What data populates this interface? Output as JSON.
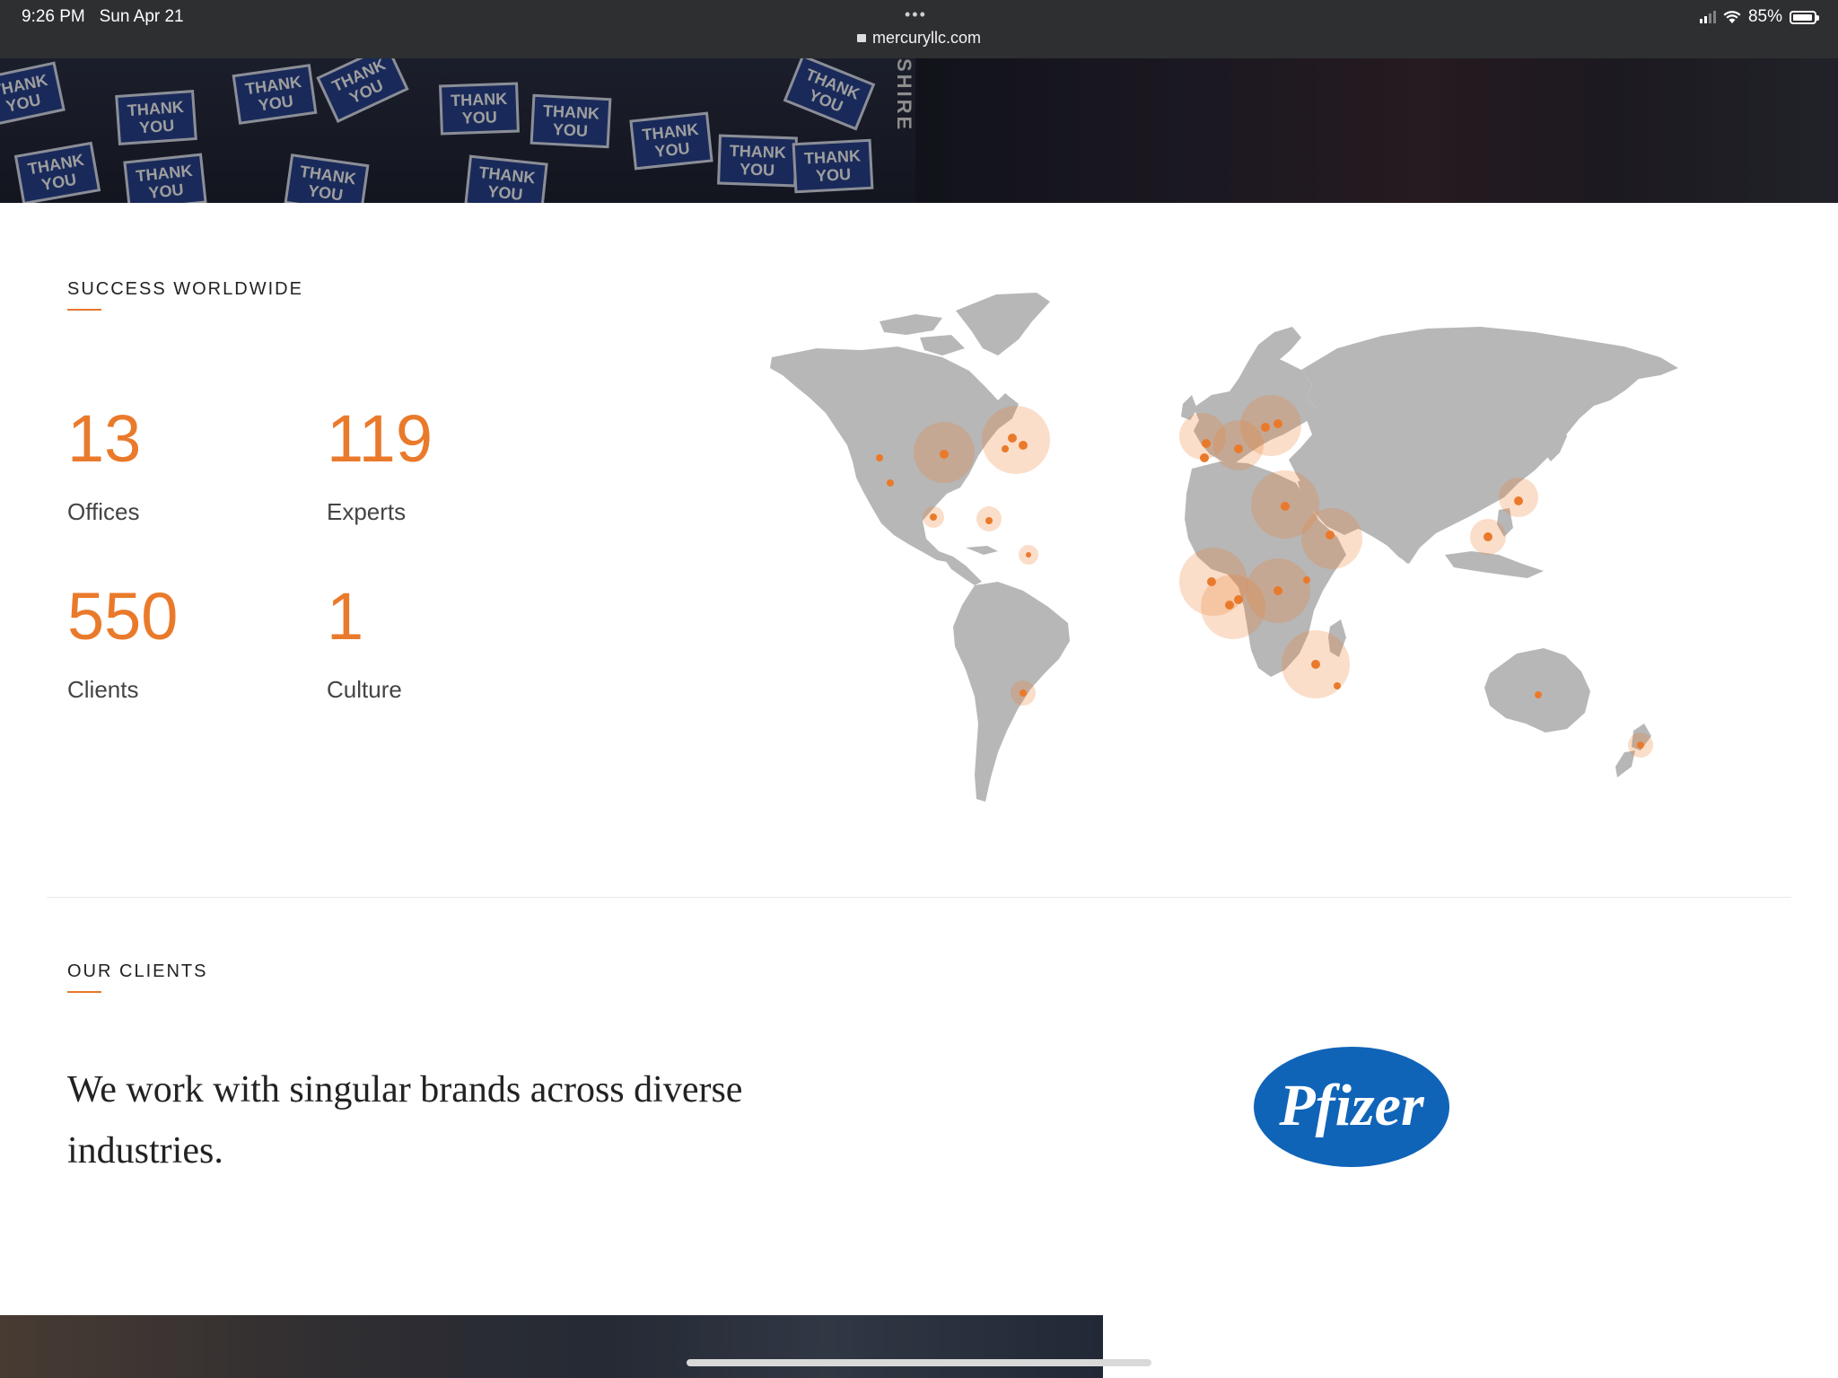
{
  "status_bar": {
    "time": "9:26 PM",
    "date": "Sun Apr 21",
    "url": "mercuryllc.com",
    "battery": "85%",
    "more_dots": "•••"
  },
  "hero": {
    "sign_text": "THANK YOU",
    "vertical_text": "SHIRE"
  },
  "success": {
    "heading": "SUCCESS WORLDWIDE",
    "stats": [
      {
        "value": "13",
        "label": "Offices"
      },
      {
        "value": "119",
        "label": "Experts"
      },
      {
        "value": "550",
        "label": "Clients"
      },
      {
        "value": "1",
        "label": "Culture"
      }
    ]
  },
  "clients": {
    "heading": "OUR CLIENTS",
    "tagline": "We work with singular brands across diverse industries.",
    "logo_text": "Pfizer"
  },
  "colors": {
    "accent": "#ea7a2b",
    "map_land": "#b5b5b5",
    "pfizer_blue": "#1064b8",
    "status_bar": "#2e2f31"
  },
  "icons": [
    "lock-icon",
    "signal-icon",
    "wifi-icon",
    "battery-icon"
  ]
}
